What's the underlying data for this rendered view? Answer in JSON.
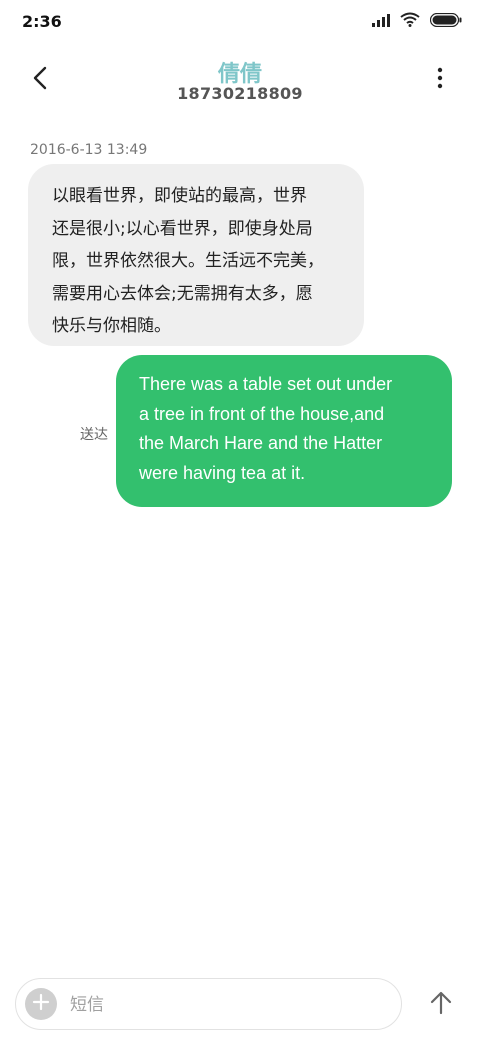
{
  "status_bar": {
    "time": "2:36",
    "icons": [
      "signal-icon",
      "wifi-icon",
      "battery-icon"
    ]
  },
  "header": {
    "back_icon": "back-arrow-icon",
    "contact_name": "倩倩",
    "contact_number": "18730218809",
    "more_icon": "more-vertical-icon",
    "name_color": "#7fc6c9"
  },
  "conversation": {
    "timestamp": "2016-6-13 13:49",
    "messages": [
      {
        "direction": "incoming",
        "lines": [
          "以眼看世界，即使站的最高，世界",
          "还是很小;以心看世界，即使身处局",
          "限，世界依然很大。生活远不完美，",
          "需要用心去体会;无需拥有太多，愿",
          "快乐与你相随。"
        ],
        "bubble_color": "#efefef"
      },
      {
        "direction": "outgoing",
        "status": "送达",
        "lines": [
          "There was a table set out under",
          "a tree in front of the house,and",
          "the March Hare and the Hatter",
          "were having tea at it."
        ],
        "bubble_color": "#33c06e"
      }
    ]
  },
  "composer": {
    "add_icon": "plus-icon",
    "placeholder": "短信",
    "send_icon": "send-arrow-up-icon"
  }
}
